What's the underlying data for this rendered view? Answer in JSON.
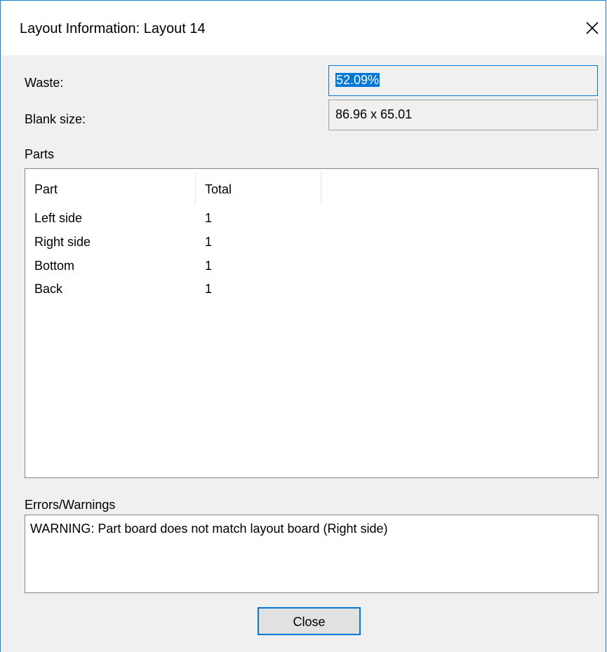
{
  "window": {
    "title": "Layout Information: Layout 14",
    "accent_color": "#0078d7",
    "close_icon": "close-icon"
  },
  "info": {
    "waste_label": "Waste:",
    "waste_value": "52.09%",
    "blank_size_label": "Blank size:",
    "blank_size_value": "86.96 x 65.01"
  },
  "parts": {
    "group_label": "Parts",
    "columns": [
      "Part",
      "Total"
    ],
    "rows": [
      {
        "part": "Left side",
        "total": "1"
      },
      {
        "part": "Right side",
        "total": "1"
      },
      {
        "part": "Bottom",
        "total": "1"
      },
      {
        "part": "Back",
        "total": "1"
      }
    ]
  },
  "errors": {
    "group_label": "Errors/Warnings",
    "text": "WARNING: Part board does not match layout board (Right side)"
  },
  "footer": {
    "close_label": "Close"
  }
}
